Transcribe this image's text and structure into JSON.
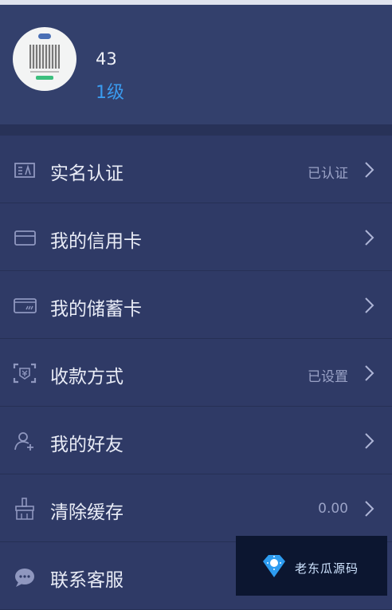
{
  "profile": {
    "user_id": "43",
    "level": "1级"
  },
  "menu": {
    "items": [
      {
        "label": "实名认证",
        "status": "已认证",
        "icon": "id-card-icon"
      },
      {
        "label": "我的信用卡",
        "status": "",
        "icon": "credit-card-icon"
      },
      {
        "label": "我的储蓄卡",
        "status": "",
        "icon": "debit-card-icon"
      },
      {
        "label": "收款方式",
        "status": "已设置",
        "icon": "payment-scan-icon"
      },
      {
        "label": "我的好友",
        "status": "",
        "icon": "add-friend-icon"
      },
      {
        "label": "清除缓存",
        "status": "0.00",
        "icon": "broom-icon"
      },
      {
        "label": "联系客服",
        "status": "",
        "icon": "chat-icon"
      }
    ]
  },
  "watermark": {
    "text": "老东瓜源码"
  },
  "colors": {
    "background": "#2f3a66",
    "level": "#3a9bef",
    "text": "#e9ecf6",
    "muted": "#9aa2c6"
  }
}
